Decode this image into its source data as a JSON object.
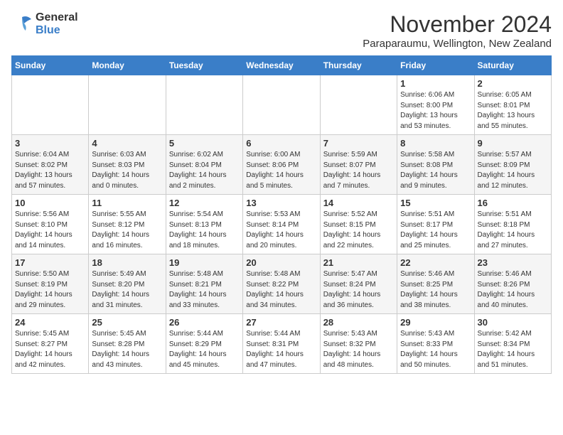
{
  "logo": {
    "general": "General",
    "blue": "Blue"
  },
  "title": "November 2024",
  "location": "Paraparaumu, Wellington, New Zealand",
  "days_of_week": [
    "Sunday",
    "Monday",
    "Tuesday",
    "Wednesday",
    "Thursday",
    "Friday",
    "Saturday"
  ],
  "weeks": [
    [
      {
        "day": "",
        "text": ""
      },
      {
        "day": "",
        "text": ""
      },
      {
        "day": "",
        "text": ""
      },
      {
        "day": "",
        "text": ""
      },
      {
        "day": "",
        "text": ""
      },
      {
        "day": "1",
        "text": "Sunrise: 6:06 AM\nSunset: 8:00 PM\nDaylight: 13 hours and 53 minutes."
      },
      {
        "day": "2",
        "text": "Sunrise: 6:05 AM\nSunset: 8:01 PM\nDaylight: 13 hours and 55 minutes."
      }
    ],
    [
      {
        "day": "3",
        "text": "Sunrise: 6:04 AM\nSunset: 8:02 PM\nDaylight: 13 hours and 57 minutes."
      },
      {
        "day": "4",
        "text": "Sunrise: 6:03 AM\nSunset: 8:03 PM\nDaylight: 14 hours and 0 minutes."
      },
      {
        "day": "5",
        "text": "Sunrise: 6:02 AM\nSunset: 8:04 PM\nDaylight: 14 hours and 2 minutes."
      },
      {
        "day": "6",
        "text": "Sunrise: 6:00 AM\nSunset: 8:06 PM\nDaylight: 14 hours and 5 minutes."
      },
      {
        "day": "7",
        "text": "Sunrise: 5:59 AM\nSunset: 8:07 PM\nDaylight: 14 hours and 7 minutes."
      },
      {
        "day": "8",
        "text": "Sunrise: 5:58 AM\nSunset: 8:08 PM\nDaylight: 14 hours and 9 minutes."
      },
      {
        "day": "9",
        "text": "Sunrise: 5:57 AM\nSunset: 8:09 PM\nDaylight: 14 hours and 12 minutes."
      }
    ],
    [
      {
        "day": "10",
        "text": "Sunrise: 5:56 AM\nSunset: 8:10 PM\nDaylight: 14 hours and 14 minutes."
      },
      {
        "day": "11",
        "text": "Sunrise: 5:55 AM\nSunset: 8:12 PM\nDaylight: 14 hours and 16 minutes."
      },
      {
        "day": "12",
        "text": "Sunrise: 5:54 AM\nSunset: 8:13 PM\nDaylight: 14 hours and 18 minutes."
      },
      {
        "day": "13",
        "text": "Sunrise: 5:53 AM\nSunset: 8:14 PM\nDaylight: 14 hours and 20 minutes."
      },
      {
        "day": "14",
        "text": "Sunrise: 5:52 AM\nSunset: 8:15 PM\nDaylight: 14 hours and 22 minutes."
      },
      {
        "day": "15",
        "text": "Sunrise: 5:51 AM\nSunset: 8:17 PM\nDaylight: 14 hours and 25 minutes."
      },
      {
        "day": "16",
        "text": "Sunrise: 5:51 AM\nSunset: 8:18 PM\nDaylight: 14 hours and 27 minutes."
      }
    ],
    [
      {
        "day": "17",
        "text": "Sunrise: 5:50 AM\nSunset: 8:19 PM\nDaylight: 14 hours and 29 minutes."
      },
      {
        "day": "18",
        "text": "Sunrise: 5:49 AM\nSunset: 8:20 PM\nDaylight: 14 hours and 31 minutes."
      },
      {
        "day": "19",
        "text": "Sunrise: 5:48 AM\nSunset: 8:21 PM\nDaylight: 14 hours and 33 minutes."
      },
      {
        "day": "20",
        "text": "Sunrise: 5:48 AM\nSunset: 8:22 PM\nDaylight: 14 hours and 34 minutes."
      },
      {
        "day": "21",
        "text": "Sunrise: 5:47 AM\nSunset: 8:24 PM\nDaylight: 14 hours and 36 minutes."
      },
      {
        "day": "22",
        "text": "Sunrise: 5:46 AM\nSunset: 8:25 PM\nDaylight: 14 hours and 38 minutes."
      },
      {
        "day": "23",
        "text": "Sunrise: 5:46 AM\nSunset: 8:26 PM\nDaylight: 14 hours and 40 minutes."
      }
    ],
    [
      {
        "day": "24",
        "text": "Sunrise: 5:45 AM\nSunset: 8:27 PM\nDaylight: 14 hours and 42 minutes."
      },
      {
        "day": "25",
        "text": "Sunrise: 5:45 AM\nSunset: 8:28 PM\nDaylight: 14 hours and 43 minutes."
      },
      {
        "day": "26",
        "text": "Sunrise: 5:44 AM\nSunset: 8:29 PM\nDaylight: 14 hours and 45 minutes."
      },
      {
        "day": "27",
        "text": "Sunrise: 5:44 AM\nSunset: 8:31 PM\nDaylight: 14 hours and 47 minutes."
      },
      {
        "day": "28",
        "text": "Sunrise: 5:43 AM\nSunset: 8:32 PM\nDaylight: 14 hours and 48 minutes."
      },
      {
        "day": "29",
        "text": "Sunrise: 5:43 AM\nSunset: 8:33 PM\nDaylight: 14 hours and 50 minutes."
      },
      {
        "day": "30",
        "text": "Sunrise: 5:42 AM\nSunset: 8:34 PM\nDaylight: 14 hours and 51 minutes."
      }
    ]
  ]
}
